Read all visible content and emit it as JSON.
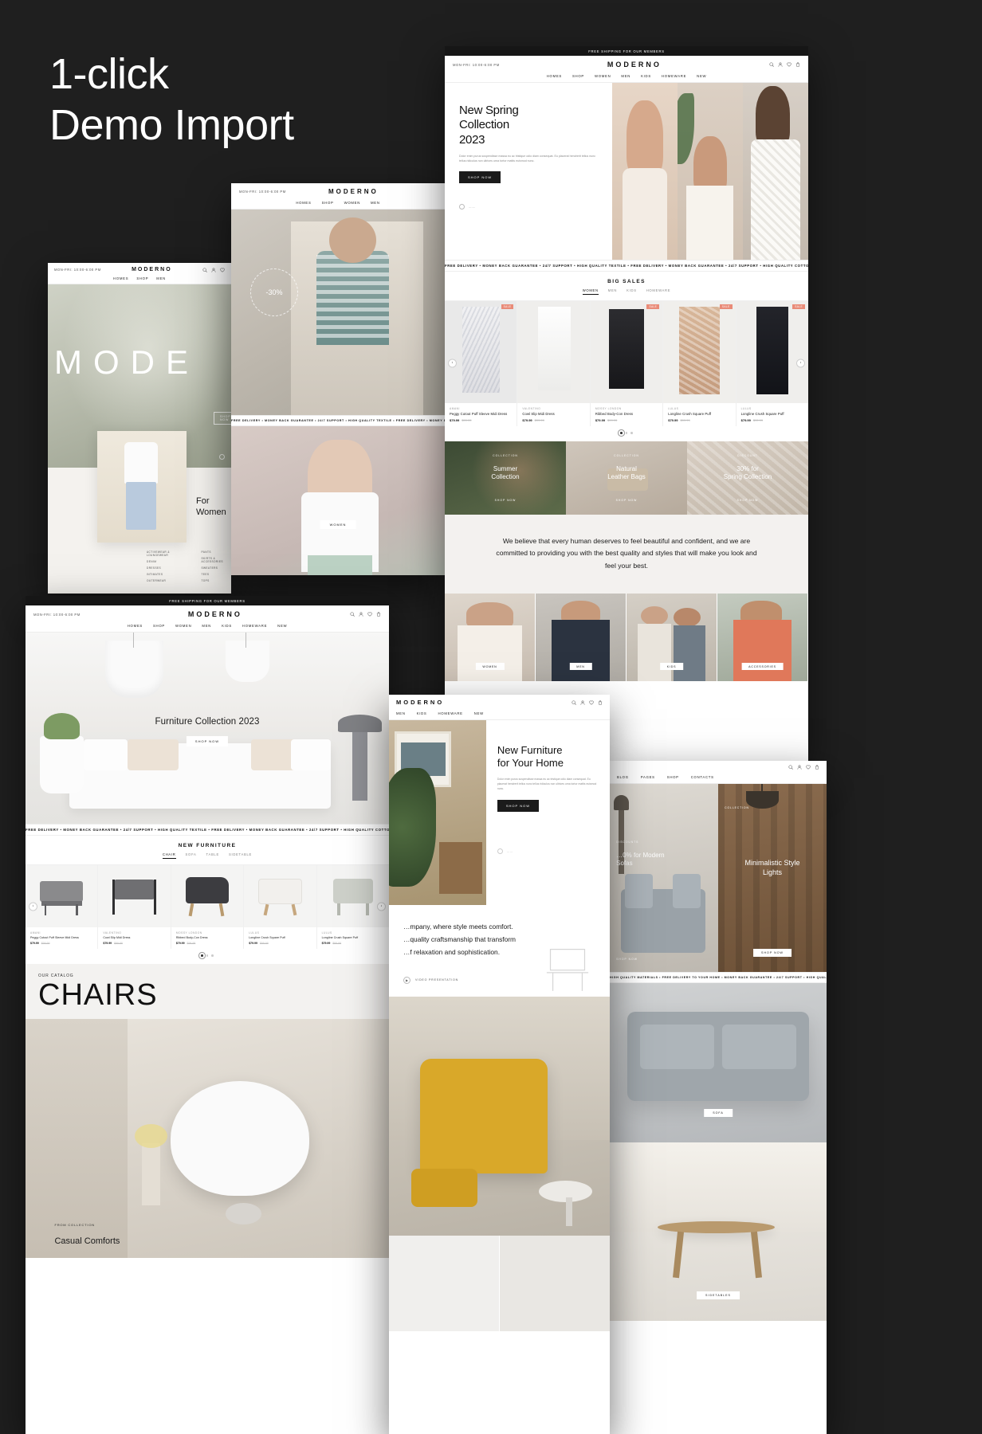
{
  "headline": {
    "line1": "1-click",
    "line2": "Demo Import"
  },
  "theme": {
    "brand": "MODERNO",
    "accent": "#e98b78",
    "dark": "#1f1f1f"
  },
  "common": {
    "announce": "FREE SHIPPING FOR OUR MEMBERS",
    "hours": "MON-FRI: 10:00-6:00 PM",
    "nav_fashion": [
      "HOMES",
      "SHOP",
      "WOMEN",
      "MEN",
      "KIDS",
      "HOMEWARE",
      "NEW"
    ],
    "nav_furniture": [
      "HOMES",
      "SHOP",
      "WOMEN",
      "MEN",
      "KIDS",
      "HOMEWARE",
      "NEW"
    ],
    "nav_short": [
      "MEN",
      "KIDS",
      "HOMEWARE",
      "NEW"
    ],
    "nav_blog": [
      "BLOG",
      "PAGES",
      "SHOP",
      "CONTACTS"
    ],
    "marquee_textile": "FREE DELIVERY  •  MONEY BACK GUARANTEE  •  24/7 SUPPORT  •  HIGH QUALITY TEXTILE  •  FREE DELIVERY  •  MONEY BACK GUARANTEE  •  24/7 SUPPORT  •  HIGH QUALITY COTTON  •  FREE DELIVERY  •  MONEY BACK GUARANTEE  •",
    "marquee_cotton": "FREE DELIVERY  •  MONEY BACK GUARANTEE  •  24/7 SUPPORT  •  HIGH QUALITY TEXTILE  •  FREE DELIVERY  •  MONEY BACK GUARANTEE  •  24/7 SUPPORT  •  HIGH QUALITY COTTON  •  FREE DELIVERY  •  M",
    "marquee_materials": "HIGH QUALITY MATERIALS  •  FREE DELIVERY TO YOUR HOME  •  MONEY BACK GUARANTEE  •  24/7 SUPPORT  •  HIGH QUALITY MATERIALS  •",
    "shop_now": "SHOP NOW",
    "icons": {
      "search": "search-icon",
      "account": "user-icon",
      "wishlist": "heart-icon",
      "cart": "cart-icon"
    }
  },
  "fashion_main": {
    "hero": {
      "title_l1": "New Spring",
      "title_l2": "Collection",
      "title_l3": "2023",
      "paragraph": "Dolor enim purus suspendisse massa eu ac tristique odio diam consequat. Eu placerat hendrerit tellus nunc tellus ridiculus non ultrices urna tortor mattis euismod nunc.",
      "cta": "SHOP NOW"
    },
    "sales": {
      "title": "BIG SALES",
      "tabs": [
        "WOMEN",
        "MEN",
        "KIDS",
        "HOMEWARE"
      ],
      "active_tab": "WOMEN",
      "products": [
        {
          "brand": "AMANI",
          "name": "Peggy Cutout Puff Sleeve Midi Dress",
          "price": "$79.99",
          "old": "$99.99",
          "badge": "SALE"
        },
        {
          "brand": "VALENTINO",
          "name": "Cowl Slip Midi Dress",
          "price": "$79.99",
          "old": "$99.99",
          "badge": ""
        },
        {
          "brand": "MOSSY LONDON",
          "name": "Ribbed Body-Con Dress",
          "price": "$79.99",
          "old": "$99.99",
          "badge": "SALE"
        },
        {
          "brand": "LULUS",
          "name": "Longline Crush Square Puff",
          "price": "$79.99",
          "old": "$99.99",
          "badge": "SALE"
        },
        {
          "brand": "LULUS",
          "name": "Longline Crush Square Puff",
          "price": "$79.99",
          "old": "$99.99",
          "badge": "SALE"
        }
      ]
    },
    "bands": [
      {
        "label": "COLLECTION",
        "title_l1": "Summer",
        "title_l2": "Collection",
        "cta": "SHOP NOW"
      },
      {
        "label": "COLLECTION",
        "title_l1": "Natural",
        "title_l2": "Leather Bags",
        "cta": "SHOP NOW"
      },
      {
        "label": "DISCOUNT",
        "title_l1": "30% for",
        "title_l2": "Spring Collection",
        "cta": "SHOP NOW"
      }
    ],
    "quote": "We believe that every human deserves to feel beautiful and confident, and we are committed to providing you with the best quality and styles that will make you look and feel your best.",
    "categories": [
      "WOMEN",
      "MEN",
      "KIDS",
      "ACCESSORIES"
    ]
  },
  "women_sale": {
    "discount_badge": "-30%",
    "brand": "MODERNO",
    "hours": "MON-FRI: 10:00-6:00 PM",
    "nav": [
      "HOMES",
      "SHOP",
      "WOMEN",
      "MEN"
    ],
    "pill": "WOMEN"
  },
  "women_listing": {
    "brand": "MODERNO",
    "hours": "MON-FRI: 10:00-6:00 PM",
    "nav": [
      "HOMES",
      "SHOP",
      "MEN"
    ],
    "hero_word": "MODE",
    "cta": "SHOP NOW",
    "card_title_l1": "For",
    "card_title_l2": "Women",
    "link_cols": [
      [
        "ACTIVEWEAR & LOUNGEWEAR",
        "DENIM",
        "DRESSES",
        "INTIMATES",
        "OUTERWEAR"
      ],
      [
        "PANTS",
        "SKIRTS & ACCESSORIES",
        "SWEATERS",
        "TEES",
        "TOPS"
      ]
    ]
  },
  "furniture_main": {
    "hero": {
      "title": "Furniture Collection 2023",
      "cta": "SHOP NOW"
    },
    "section": {
      "title": "NEW FURNITURE",
      "tabs": [
        "CHAIR",
        "SOFA",
        "TABLE",
        "SIDETABLE"
      ],
      "active_tab": "CHAIR",
      "products": [
        {
          "brand": "AMANI",
          "name": "Peggy Cutout Puff Sleeve Midi Dress",
          "price": "$79.99",
          "old": "$99.99"
        },
        {
          "brand": "VALENTINO",
          "name": "Cowl Slip Midi Dress",
          "price": "$79.99",
          "old": "$99.99"
        },
        {
          "brand": "MOSSY LONDON",
          "name": "Ribbed Body-Con Dress",
          "price": "$79.99",
          "old": "$99.99"
        },
        {
          "brand": "LULUS",
          "name": "Longline Crush Square Puff",
          "price": "$79.99",
          "old": "$99.99"
        },
        {
          "brand": "LULUS",
          "name": "Longline Crush Square Puff",
          "price": "$79.99",
          "old": "$99.99"
        }
      ]
    },
    "catalog": {
      "eyebrow": "OUR CATALOG",
      "title": "CHAIRS"
    },
    "collection": {
      "eyebrow": "FROM COLLECTION",
      "title": "Casual Comforts"
    }
  },
  "furniture_hero": {
    "brand": "MODERNO",
    "nav": [
      "MEN",
      "KIDS",
      "HOMEWARE",
      "NEW"
    ],
    "title_l1": "New Furniture",
    "title_l2": "for Your Home",
    "paragraph": "Dolor enim purus suspendisse massa eu ac tristique odio diam consequat. Eu placerat hendrerit tellus nunc tellus ridiculus non ultrices urna tortor mattis euismod nunc.",
    "cta": "SHOP NOW",
    "about_l1": "…mpany, where style meets comfort.",
    "about_l2": "…quality craftsmanship that transform",
    "about_l3": "…f relaxation and sophistication.",
    "video_label": "VIDEO PRESENTATION"
  },
  "lights": {
    "nav": [
      "BLOG",
      "PAGES",
      "SHOP",
      "CONTACTS"
    ],
    "left": {
      "eyebrow": "DISCOUNTS",
      "title_l1": "…0% for Modern",
      "title_l2": "Sofas",
      "cta": "SHOP NOW"
    },
    "right": {
      "eyebrow": "COLLECTION",
      "title_l1": "Minimalistic Style",
      "title_l2": "Lights",
      "cta": "SHOP NOW"
    },
    "marquee": "HIGH QUALITY MATERIALS  •  FREE DELIVERY TO YOUR HOME  •  MONEY BACK GUARANTEE  •  24/7 SUPPORT  •  HIGH QUALITY MATERIALS  •",
    "pill_sofa": "SOFA",
    "pill_sidetables": "SIDETABLES"
  }
}
